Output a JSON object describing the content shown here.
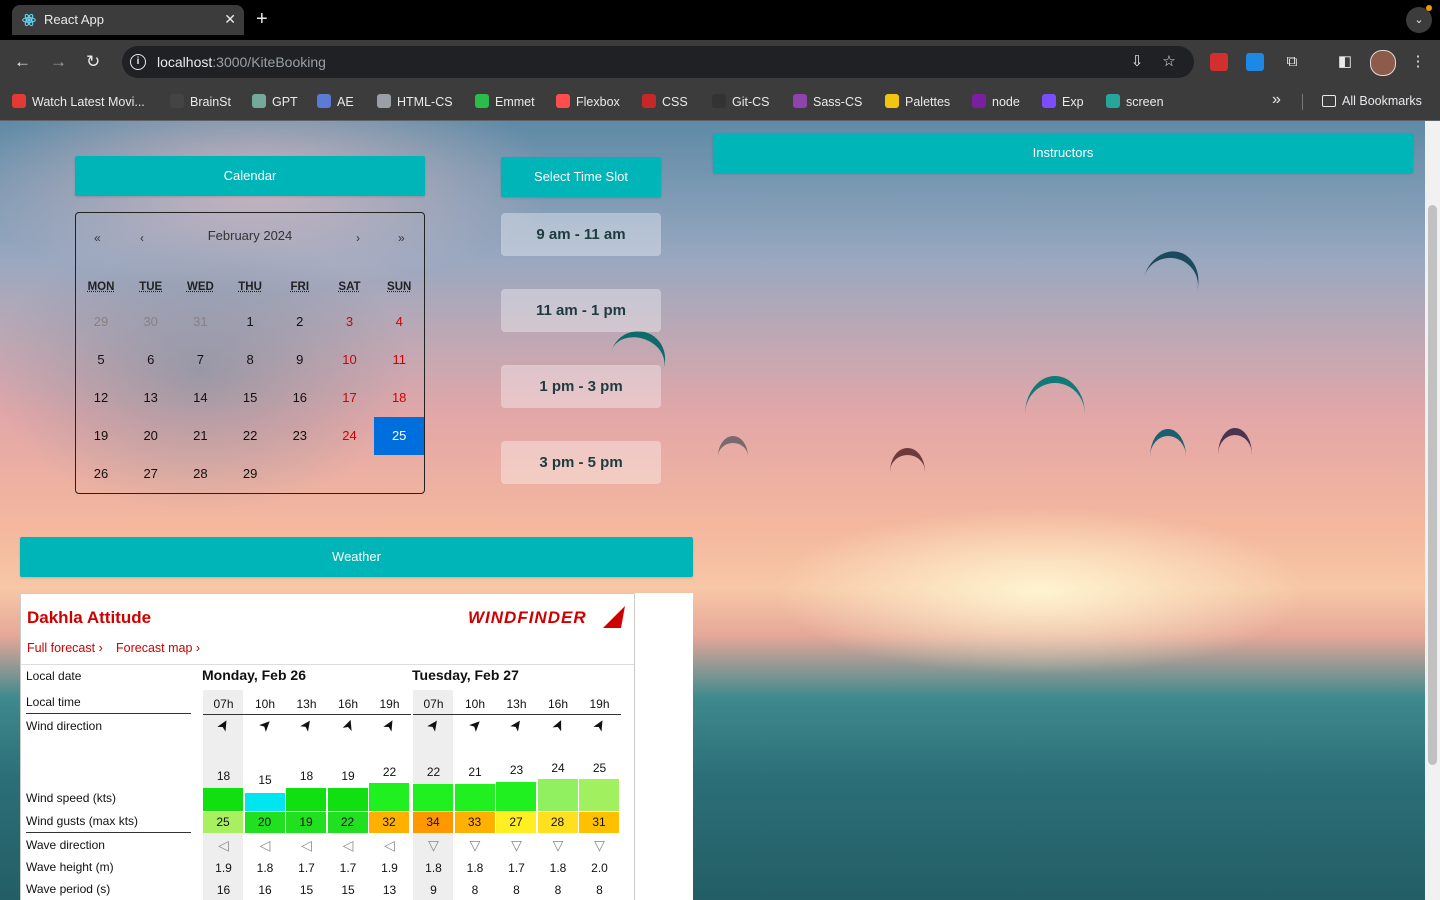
{
  "browser": {
    "tab_title": "React App",
    "url_host": "localhost",
    "url_path": ":3000/KiteBooking",
    "bookmarks": [
      {
        "label": "Watch Latest Movi...",
        "icon": "movie-icon",
        "color": "#e53935"
      },
      {
        "label": "BrainSt",
        "icon": "brain-icon",
        "color": "#444444"
      },
      {
        "label": "GPT",
        "icon": "openai-icon",
        "color": "#74aa9c"
      },
      {
        "label": "AE",
        "icon": "x-icon",
        "color": "#5b7bd5"
      },
      {
        "label": "HTML-CS",
        "icon": "globe-icon",
        "color": "#9aa0a6"
      },
      {
        "label": "Emmet",
        "icon": "emmet-icon",
        "color": "#2bbd4a"
      },
      {
        "label": "Flexbox",
        "icon": "flexbox-icon",
        "color": "#ff4d4d"
      },
      {
        "label": "CSS",
        "icon": "css-icon",
        "color": "#c62828"
      },
      {
        "label": "Git-CS",
        "icon": "github-icon",
        "color": "#333333"
      },
      {
        "label": "Sass-CS",
        "icon": "sass-icon",
        "color": "#8e44ad"
      },
      {
        "label": "Palettes",
        "icon": "palette-icon",
        "color": "#f1c40f"
      },
      {
        "label": "node",
        "icon": "w-icon",
        "color": "#7b1fa2"
      },
      {
        "label": "Exp",
        "icon": "exp-icon",
        "color": "#7c4dff"
      },
      {
        "label": "screen",
        "icon": "screen-icon",
        "color": "#26a69a"
      }
    ],
    "all_bookmarks": "All Bookmarks"
  },
  "headers": {
    "calendar": "Calendar",
    "time_slot": "Select Time Slot",
    "instructors": "Instructors",
    "weather": "Weather"
  },
  "calendar": {
    "month_label": "February 2024",
    "nav": {
      "prev_year": "«",
      "prev": "‹",
      "next": "›",
      "next_year": "»"
    },
    "weekdays": [
      "MON",
      "TUE",
      "WED",
      "THU",
      "FRI",
      "SAT",
      "SUN"
    ],
    "weeks": [
      [
        "29",
        "30",
        "31",
        "1",
        "2",
        "3",
        "4"
      ],
      [
        "5",
        "6",
        "7",
        "8",
        "9",
        "10",
        "11"
      ],
      [
        "12",
        "13",
        "14",
        "15",
        "16",
        "17",
        "18"
      ],
      [
        "19",
        "20",
        "21",
        "22",
        "23",
        "24",
        "25"
      ],
      [
        "26",
        "27",
        "28",
        "29",
        "",
        "",
        ""
      ]
    ],
    "selected_day": "25"
  },
  "time_slots": [
    "9 am - 11 am",
    "11 am - 1 pm",
    "1 pm - 3 pm",
    "3 pm - 5 pm"
  ],
  "weather": {
    "spot": "Dakhla Attitude",
    "full_forecast": "Full forecast",
    "forecast_map": "Forecast map",
    "brand": "WINDFINDER",
    "labels": {
      "local_date": "Local date",
      "local_time": "Local time",
      "wind_direction": "Wind direction",
      "wind_speed": "Wind speed (kts)",
      "wind_gusts": "Wind gusts (max kts)",
      "wave_direction": "Wave direction",
      "wave_height": "Wave height (m)",
      "wave_period": "Wave period (s)"
    },
    "days": [
      {
        "date": "Monday, Feb 26",
        "hours": [
          "07h",
          "10h",
          "13h",
          "16h",
          "19h"
        ],
        "speed": [
          "18",
          "15",
          "18",
          "19",
          "22"
        ],
        "speed_colors": [
          "#10e010",
          "#00e5ee",
          "#10e010",
          "#10e010",
          "#20f020"
        ],
        "gusts": [
          "25",
          "20",
          "19",
          "22",
          "32"
        ],
        "gust_colors": [
          "#a8f060",
          "#20e020",
          "#20e020",
          "#20e020",
          "#ffb000"
        ],
        "wave_height": [
          "1.9",
          "1.8",
          "1.7",
          "1.7",
          "1.9"
        ],
        "wave_period": [
          "16",
          "16",
          "15",
          "15",
          "13"
        ]
      },
      {
        "date": "Tuesday, Feb 27",
        "hours": [
          "07h",
          "10h",
          "13h",
          "16h",
          "19h"
        ],
        "speed": [
          "22",
          "21",
          "23",
          "24",
          "25"
        ],
        "speed_colors": [
          "#20f020",
          "#20f020",
          "#20f020",
          "#90f060",
          "#a0f060"
        ],
        "gusts": [
          "34",
          "33",
          "27",
          "28",
          "31"
        ],
        "gust_colors": [
          "#ff9800",
          "#ffb000",
          "#ffee22",
          "#ffe020",
          "#ffc000"
        ],
        "wave_height": [
          "1.8",
          "1.8",
          "1.7",
          "1.8",
          "2.0"
        ],
        "wave_period": [
          "9",
          "8",
          "8",
          "8",
          "8"
        ]
      }
    ]
  }
}
